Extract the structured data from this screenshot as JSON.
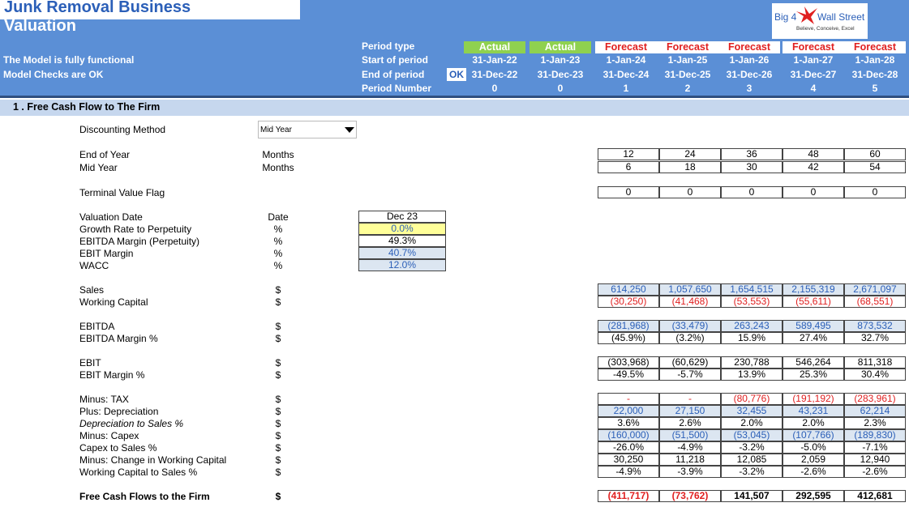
{
  "title": {
    "line1": "Junk Removal Business",
    "line2": "Valuation"
  },
  "logo": {
    "left": "Big 4",
    "right": "Wall Street",
    "tagline": "Believe, Conceive, Excel"
  },
  "status": {
    "functional": "The Model is fully functional",
    "checks": "Model Checks are OK",
    "ok_badge": "OK"
  },
  "period_labels": {
    "type": "Period type",
    "start": "Start of period",
    "end": "End of period",
    "number": "Period Number"
  },
  "periods": [
    {
      "type": "Actual",
      "kind": "actual",
      "start": "31-Jan-22",
      "end": "31-Dec-22",
      "number": "0"
    },
    {
      "type": "Actual",
      "kind": "actual",
      "start": "1-Jan-23",
      "end": "31-Dec-23",
      "number": "0"
    },
    {
      "type": "Forecast",
      "kind": "forecast",
      "start": "1-Jan-24",
      "end": "31-Dec-24",
      "number": "1"
    },
    {
      "type": "Forecast",
      "kind": "forecast",
      "start": "1-Jan-25",
      "end": "31-Dec-25",
      "number": "2"
    },
    {
      "type": "Forecast",
      "kind": "forecast",
      "start": "1-Jan-26",
      "end": "31-Dec-26",
      "number": "3"
    },
    {
      "type": "Forecast",
      "kind": "forecast",
      "start": "1-Jan-27",
      "end": "31-Dec-27",
      "number": "4"
    },
    {
      "type": "Forecast",
      "kind": "forecast",
      "start": "1-Jan-28",
      "end": "31-Dec-28",
      "number": "5"
    }
  ],
  "section": {
    "title": "1 . Free Cash Flow to The Firm"
  },
  "discounting": {
    "label": "Discounting Method",
    "value": "Mid Year"
  },
  "rows": {
    "end_of_year": {
      "label": "End of Year",
      "unit": "Months",
      "values": [
        "12",
        "24",
        "36",
        "48",
        "60"
      ]
    },
    "mid_year": {
      "label": "Mid Year",
      "unit": "Months",
      "values": [
        "6",
        "18",
        "30",
        "42",
        "54"
      ]
    },
    "terminal_flag": {
      "label": "Terminal Value Flag",
      "values": [
        "0",
        "0",
        "0",
        "0",
        "0"
      ]
    },
    "valuation_date": {
      "label": "Valuation Date",
      "unit": "Date",
      "value": "Dec 23"
    },
    "growth_rate": {
      "label": "Growth Rate to Perpetuity",
      "unit": "%",
      "value": "0.0%"
    },
    "ebitda_margin_perp": {
      "label": "EBITDA Margin (Perpetuity)",
      "unit": "%",
      "value": "49.3%"
    },
    "ebit_margin_input": {
      "label": "EBIT Margin",
      "unit": "%",
      "value": "40.7%"
    },
    "wacc": {
      "label": "WACC",
      "unit": "%",
      "value": "12.0%"
    },
    "sales": {
      "label": "Sales",
      "unit": "$",
      "values": [
        "614,250",
        "1,057,650",
        "1,654,515",
        "2,155,319",
        "2,671,097"
      ]
    },
    "working_capital": {
      "label": "Working Capital",
      "unit": "$",
      "values": [
        "(30,250)",
        "(41,468)",
        "(53,553)",
        "(55,611)",
        "(68,551)"
      ]
    },
    "ebitda": {
      "label": "EBITDA",
      "unit": "$",
      "values": [
        "(281,968)",
        "(33,479)",
        "263,243",
        "589,495",
        "873,532"
      ]
    },
    "ebitda_margin": {
      "label": "EBITDA Margin %",
      "unit": "$",
      "values": [
        "(45.9%)",
        "(3.2%)",
        "15.9%",
        "27.4%",
        "32.7%"
      ]
    },
    "ebit": {
      "label": "EBIT",
      "unit": "$",
      "values": [
        "(303,968)",
        "(60,629)",
        "230,788",
        "546,264",
        "811,318"
      ]
    },
    "ebit_margin": {
      "label": "EBIT Margin %",
      "unit": "$",
      "values": [
        "-49.5%",
        "-5.7%",
        "13.9%",
        "25.3%",
        "30.4%"
      ]
    },
    "tax": {
      "label": "Minus: TAX",
      "unit": "$",
      "values": [
        "-",
        "-",
        "(80,776)",
        "(191,192)",
        "(283,961)"
      ]
    },
    "depreciation": {
      "label": "Plus: Depreciation",
      "unit": "$",
      "values": [
        "22,000",
        "27,150",
        "32,455",
        "43,231",
        "62,214"
      ]
    },
    "dep_to_sales": {
      "label": "Depreciation to Sales %",
      "unit": "$",
      "values": [
        "3.6%",
        "2.6%",
        "2.0%",
        "2.0%",
        "2.3%"
      ]
    },
    "capex": {
      "label": "Minus: Capex",
      "unit": "$",
      "values": [
        "(160,000)",
        "(51,500)",
        "(53,045)",
        "(107,766)",
        "(189,830)"
      ]
    },
    "capex_to_sales": {
      "label": "Capex to Sales %",
      "unit": "$",
      "values": [
        "-26.0%",
        "-4.9%",
        "-3.2%",
        "-5.0%",
        "-7.1%"
      ]
    },
    "change_wc": {
      "label": "Minus: Change in Working Capital",
      "unit": "$",
      "values": [
        "30,250",
        "11,218",
        "12,085",
        "2,059",
        "12,940"
      ]
    },
    "wc_to_sales": {
      "label": "Working Capital to Sales %",
      "unit": "$",
      "values": [
        "-4.9%",
        "-3.9%",
        "-3.2%",
        "-2.6%",
        "-2.6%"
      ]
    },
    "fcff": {
      "label": "Free Cash Flows to the Firm",
      "unit": "$",
      "values": [
        "(411,717)",
        "(73,762)",
        "141,507",
        "292,595",
        "412,681"
      ]
    }
  },
  "colors": {
    "header_blue": "#5b8fd6",
    "input_blue": "#2b5fb8",
    "negative_red": "#e02020",
    "actual_green": "#8fd14f",
    "section_bar": "#c6d7ee"
  }
}
